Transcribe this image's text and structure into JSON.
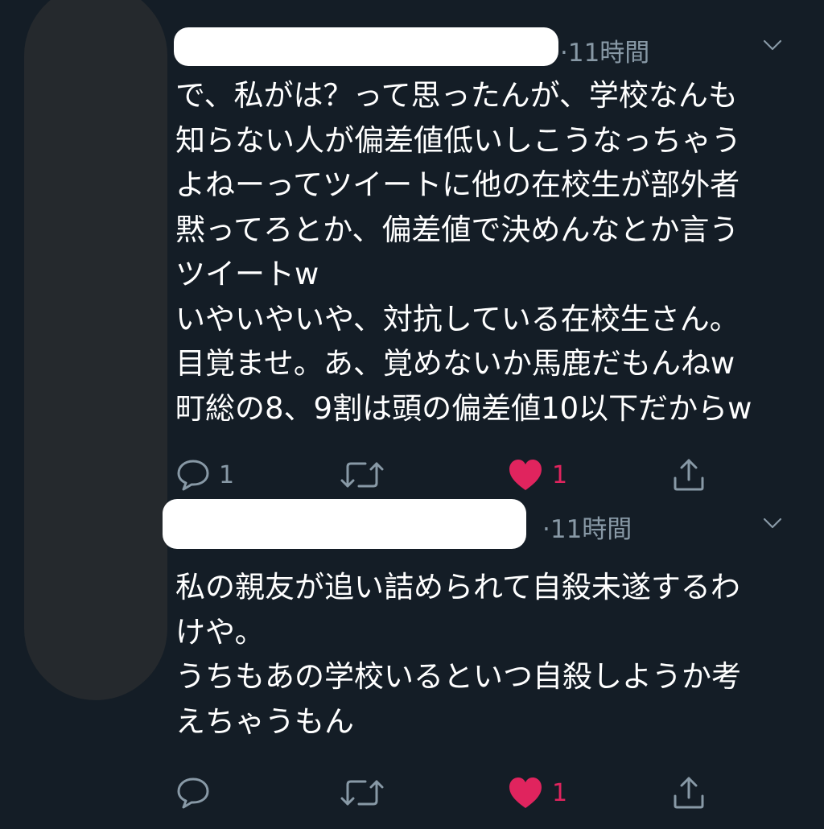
{
  "tweets": [
    {
      "time": "·11時間",
      "text": "で、私がは？って思ったんが、学校なんも\n知らない人が偏差値低いしこうなっちゃう\nよねーってツイートに他の在校生が部外者\n黙ってろとか、偏差値で決めんなとか言う\nツイートw\nいやいやいや、対抗している在校生さん。\n目覚ませ。あ、覚めないか馬鹿だもんねw\n町総の8、9割は頭の偏差値10以下だからw",
      "reply_count": "1",
      "retweet_count": "",
      "like_count": "1",
      "liked": true
    },
    {
      "time": "·11時間",
      "text": "私の親友が追い詰められて自殺未遂するわ\nけや。\nうちもあの学校いるといつ自殺しようか考\nえちゃうもん",
      "reply_count": "",
      "retweet_count": "",
      "like_count": "1",
      "liked": true
    }
  ],
  "icons": {
    "reply": "reply-icon",
    "retweet": "retweet-icon",
    "like": "heart-filled-icon",
    "share": "share-icon",
    "more": "chevron-down-icon"
  },
  "colors": {
    "background": "#141d26",
    "text": "#ffffff",
    "muted": "#8899a6",
    "like": "#e0245e"
  }
}
